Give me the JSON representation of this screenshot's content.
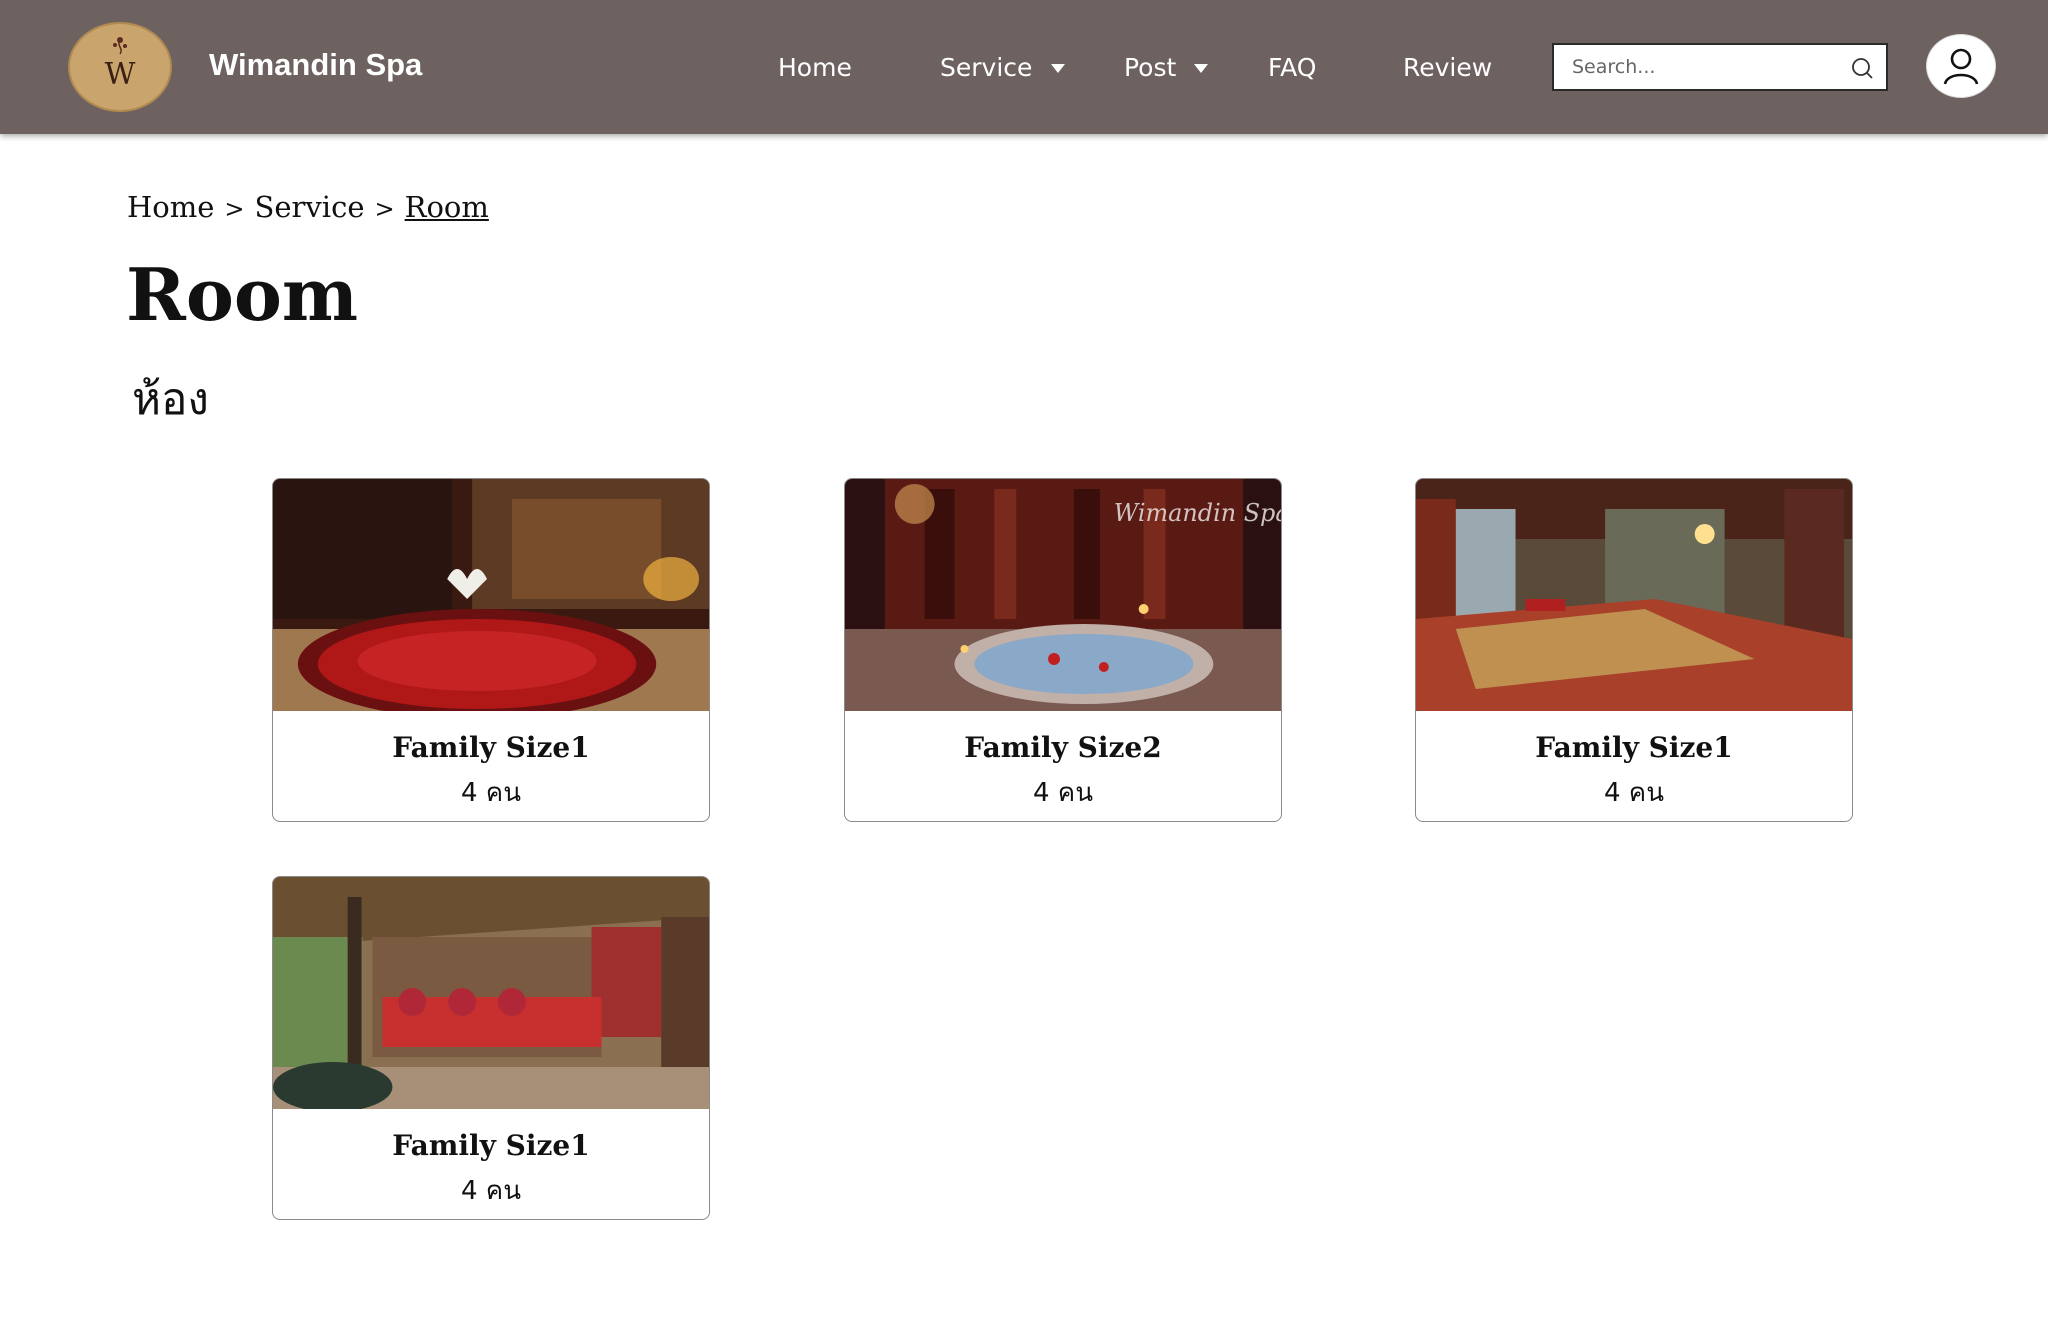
{
  "header": {
    "brand": "Wimandin Spa",
    "logo_letter": "W",
    "nav": {
      "home": "Home",
      "service": "Service",
      "post": "Post",
      "faq": "FAQ",
      "review": "Review"
    },
    "search_placeholder": "Search...",
    "bar_color": "#6e6261"
  },
  "breadcrumb": {
    "home": "Home",
    "separator": ">",
    "service": "Service",
    "current": "Room"
  },
  "page": {
    "title": "Room",
    "subtitle": "ห้อง"
  },
  "rooms": [
    {
      "name": "Family Size1",
      "capacity": "4 คน"
    },
    {
      "name": "Family Size2",
      "capacity": "4 คน",
      "photo_watermark": "Wimandin Spa"
    },
    {
      "name": "Family Size1",
      "capacity": "4 คน"
    },
    {
      "name": "Family Size1",
      "capacity": "4 คน"
    }
  ],
  "icons": {
    "search": "search-icon",
    "account": "user-account-icon",
    "dropdown": "caret-down-icon"
  }
}
